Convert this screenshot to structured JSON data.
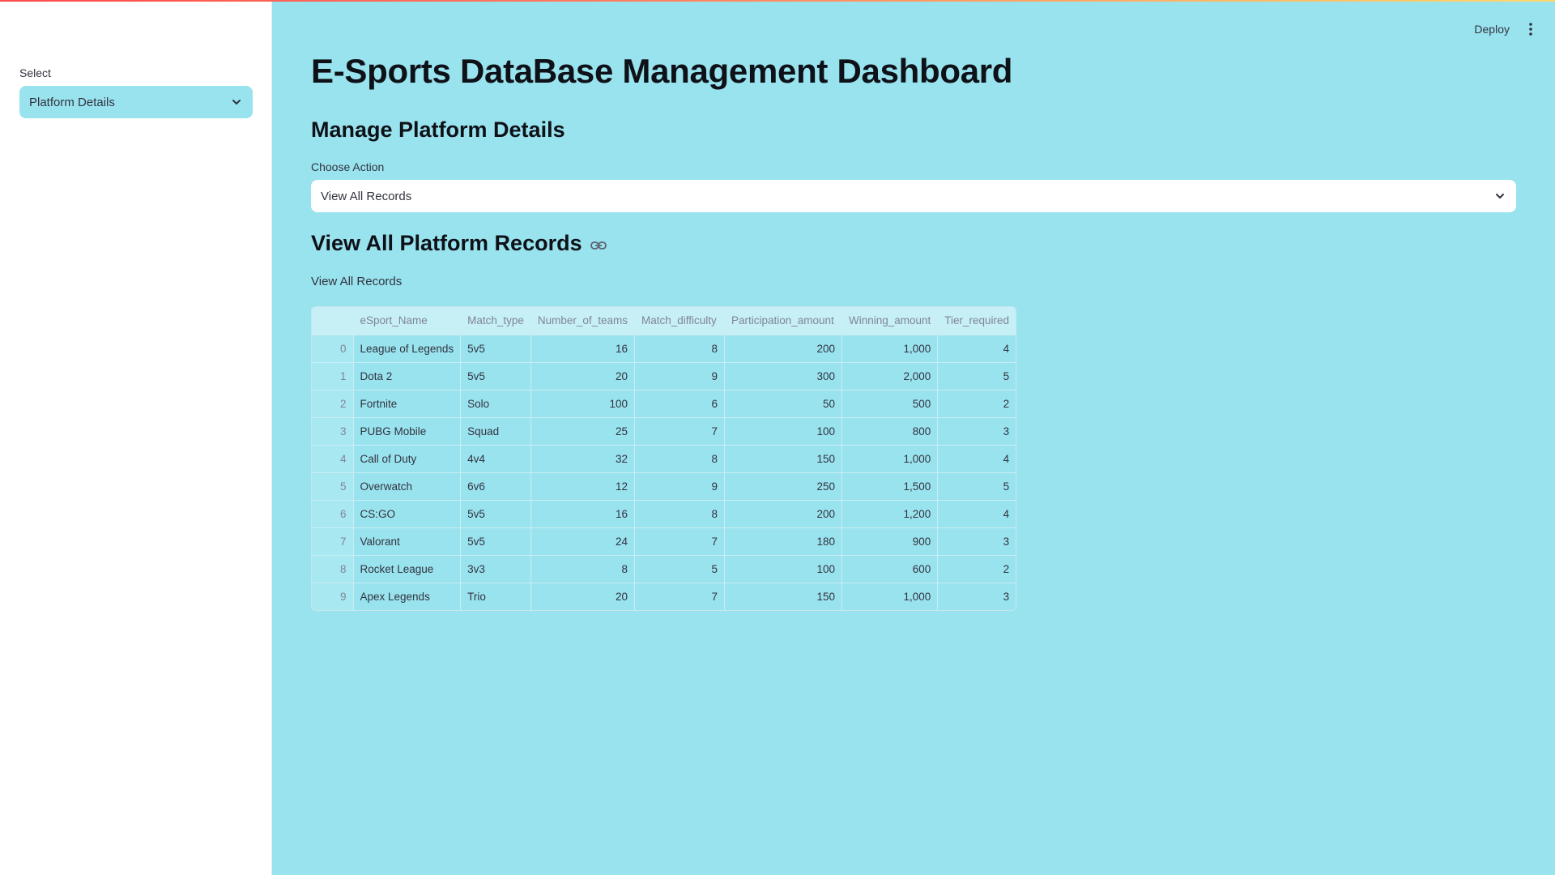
{
  "sidebar": {
    "select_label": "Select",
    "select_value": "Platform Details"
  },
  "header": {
    "deploy_label": "Deploy"
  },
  "main": {
    "title": "E-Sports DataBase Management Dashboard",
    "section_title": "Manage Platform Details",
    "action_label": "Choose Action",
    "action_value": "View All Records",
    "records_title": "View All Platform Records",
    "records_subtitle": "View All Records"
  },
  "table": {
    "columns": [
      "",
      "eSport_Name",
      "Match_type",
      "Number_of_teams",
      "Match_difficulty",
      "Participation_amount",
      "Winning_amount",
      "Tier_required"
    ],
    "rows": [
      [
        "0",
        "League of Legends",
        "5v5",
        "16",
        "8",
        "200",
        "1,000",
        "4"
      ],
      [
        "1",
        "Dota 2",
        "5v5",
        "20",
        "9",
        "300",
        "2,000",
        "5"
      ],
      [
        "2",
        "Fortnite",
        "Solo",
        "100",
        "6",
        "50",
        "500",
        "2"
      ],
      [
        "3",
        "PUBG Mobile",
        "Squad",
        "25",
        "7",
        "100",
        "800",
        "3"
      ],
      [
        "4",
        "Call of Duty",
        "4v4",
        "32",
        "8",
        "150",
        "1,000",
        "4"
      ],
      [
        "5",
        "Overwatch",
        "6v6",
        "12",
        "9",
        "250",
        "1,500",
        "5"
      ],
      [
        "6",
        "CS:GO",
        "5v5",
        "16",
        "8",
        "200",
        "1,200",
        "4"
      ],
      [
        "7",
        "Valorant",
        "5v5",
        "24",
        "7",
        "180",
        "900",
        "3"
      ],
      [
        "8",
        "Rocket League",
        "3v3",
        "8",
        "5",
        "100",
        "600",
        "2"
      ],
      [
        "9",
        "Apex Legends",
        "Trio",
        "20",
        "7",
        "150",
        "1,000",
        "3"
      ]
    ]
  },
  "colors": {
    "main_bg": "#99e3ee",
    "sidebar_bg": "#ffffff",
    "accent_gradient_start": "#ff4b4b",
    "accent_gradient_end": "#ffd86f"
  },
  "icons": {
    "select_chevron": "chevron-down-icon",
    "action_chevron": "chevron-down-icon",
    "menu": "kebab-menu-icon",
    "anchor": "link-icon"
  }
}
